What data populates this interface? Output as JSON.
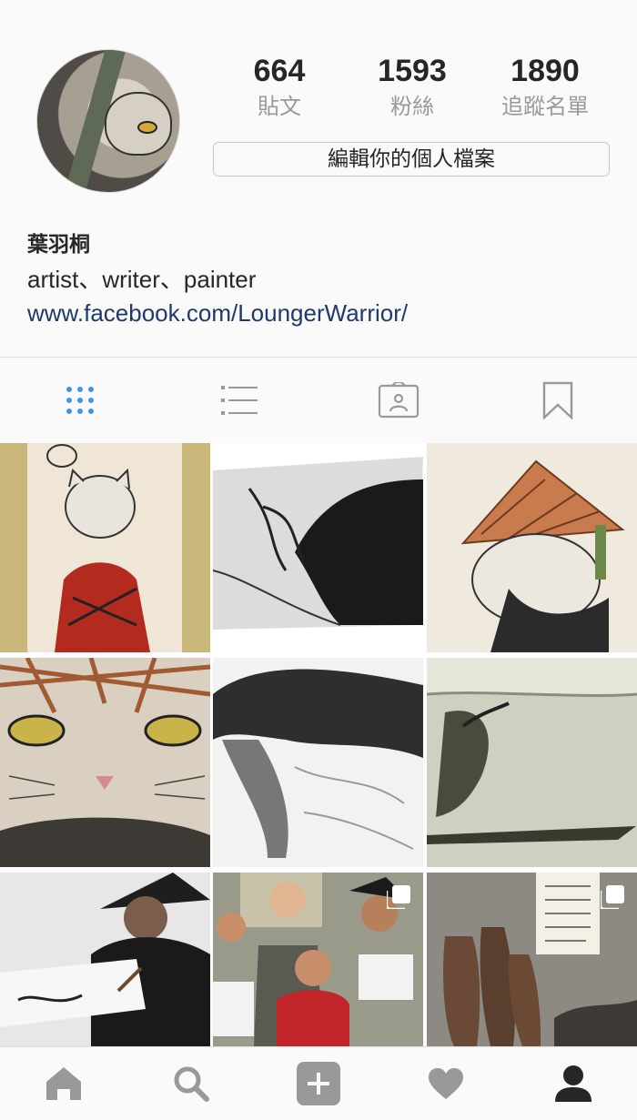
{
  "profile": {
    "stats": [
      {
        "value": "664",
        "label": "貼文"
      },
      {
        "value": "1593",
        "label": "粉絲"
      },
      {
        "value": "1890",
        "label": "追蹤名單"
      }
    ],
    "edit_label": "編輯你的個人檔案",
    "name": "葉羽桐",
    "bio": "artist、writer、painter",
    "link": "www.facebook.com/LoungerWarrior/"
  },
  "tabs": [
    {
      "icon": "grid-icon",
      "active": true
    },
    {
      "icon": "list-icon",
      "active": false
    },
    {
      "icon": "tagged-photos-icon",
      "active": false
    },
    {
      "icon": "bookmark-icon",
      "active": false
    }
  ],
  "posts": [
    {
      "subject": "cat in red kimono"
    },
    {
      "subject": "ink sketch of warrior hair"
    },
    {
      "subject": "cat with straw hat"
    },
    {
      "subject": "cat face close-up"
    },
    {
      "subject": "warrior with flowing hair"
    },
    {
      "subject": "figure on boat in lake"
    },
    {
      "subject": "artist drawing at table"
    },
    {
      "subject": "group photo with drawings",
      "multiple": true
    },
    {
      "subject": "stone statues illustration",
      "multiple": true
    }
  ],
  "colors": {
    "active_tab": "#3897f0",
    "link": "#1e3a6b",
    "icon": "#999999"
  },
  "bottom_nav": [
    "home-icon",
    "search-icon",
    "add-post-icon",
    "activity-icon",
    "profile-icon"
  ]
}
